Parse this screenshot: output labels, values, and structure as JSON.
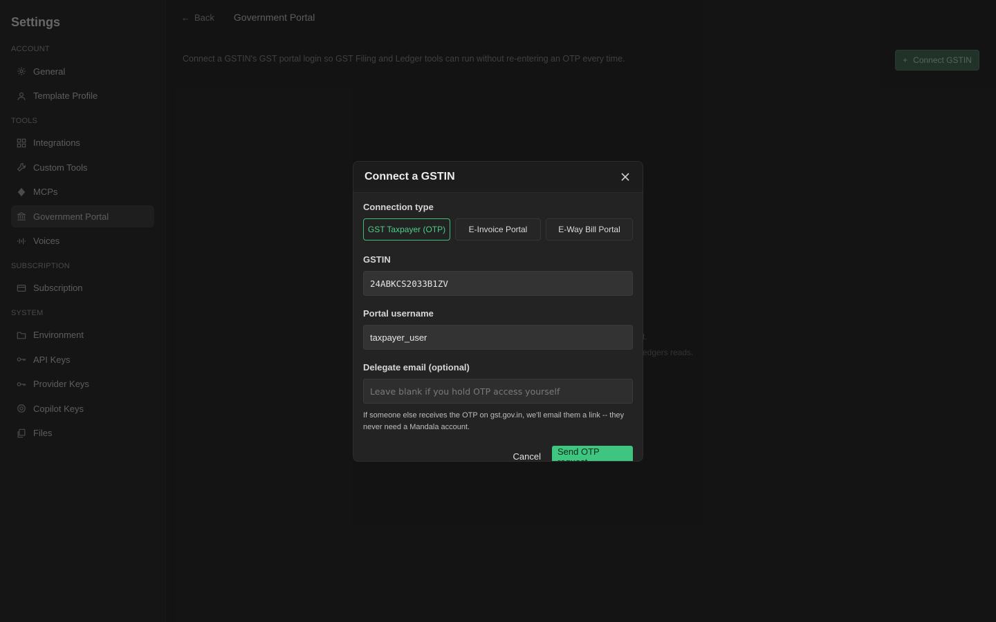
{
  "sidebar": {
    "title": "Settings",
    "sections": [
      {
        "label": "ACCOUNT",
        "items": [
          {
            "label": "General",
            "icon": "gear-icon"
          },
          {
            "label": "Template Profile",
            "icon": "user-icon"
          }
        ]
      },
      {
        "label": "TOOLS",
        "items": [
          {
            "label": "Integrations",
            "icon": "grid-icon"
          },
          {
            "label": "Custom Tools",
            "icon": "wrench-icon"
          },
          {
            "label": "MCPs",
            "icon": "plug-icon"
          },
          {
            "label": "Government Portal",
            "icon": "bank-icon",
            "active": true
          },
          {
            "label": "Voices",
            "icon": "waveform-icon"
          }
        ]
      },
      {
        "label": "SUBSCRIPTION",
        "items": [
          {
            "label": "Subscription",
            "icon": "card-icon"
          }
        ]
      },
      {
        "label": "SYSTEM",
        "items": [
          {
            "label": "Environment",
            "icon": "folder-icon"
          },
          {
            "label": "API Keys",
            "icon": "key-icon"
          },
          {
            "label": "Provider Keys",
            "icon": "key-icon"
          },
          {
            "label": "Copilot Keys",
            "icon": "copilot-icon"
          },
          {
            "label": "Files",
            "icon": "files-icon"
          }
        ]
      }
    ]
  },
  "topbar": {
    "back_label": "Back",
    "page_title": "Government Portal"
  },
  "main": {
    "description": "Connect a GSTIN's GST portal login so GST Filing and Ledger tools can run without re-entering an OTP every time.",
    "connect_button": "Connect GSTIN",
    "hint_line1": "t.",
    "hint_line2": "edgers reads."
  },
  "modal": {
    "title": "Connect a GSTIN",
    "connection_type_label": "Connection type",
    "types": [
      "GST Taxpayer (OTP)",
      "E-Invoice Portal",
      "E-Way Bill Portal"
    ],
    "selected_type": "GST Taxpayer (OTP)",
    "gstin_label": "GSTIN",
    "gstin_value": "24ABKCS2033B1ZV",
    "username_label": "Portal username",
    "username_value": "taxpayer_user",
    "delegate_label": "Delegate email (optional)",
    "delegate_placeholder": "Leave blank if you hold OTP access yourself",
    "help_text": "If someone else receives the OTP on gst.gov.in, we'll email them a link -- they never need a Mandala account.",
    "cancel_label": "Cancel",
    "submit_label": "Send OTP request"
  },
  "colors": {
    "accent": "#3ec57f",
    "background": "#1a1a1a",
    "modal": "#232323"
  }
}
